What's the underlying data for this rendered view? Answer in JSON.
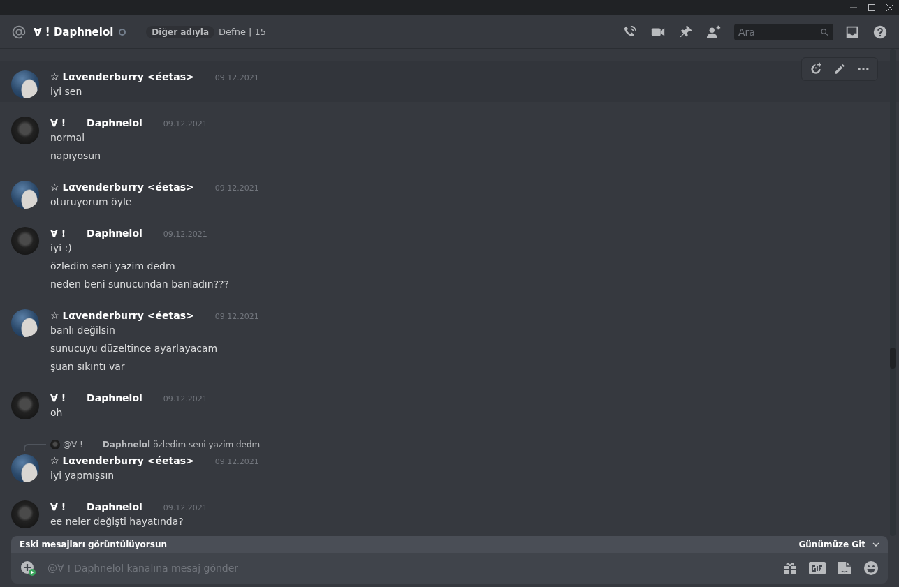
{
  "header": {
    "recipient": "∀ ! Daphnelol",
    "online": false,
    "nickname_label": "Diğer adıyla",
    "nickname": "Defne | 15",
    "search": {
      "placeholder": "Ara"
    }
  },
  "messages": [
    {
      "kind": "light",
      "author": [
        "☆ Lαvenderburry <éetas>"
      ],
      "timestamp": "09.12.2021",
      "highlighted": true,
      "lines": [
        "iyi sen"
      ]
    },
    {
      "kind": "dark",
      "author": [
        "∀ !",
        "Daphnelol"
      ],
      "timestamp": "09.12.2021",
      "highlighted": false,
      "lines": [
        "normal",
        "napıyosun"
      ]
    },
    {
      "kind": "light",
      "author": [
        "☆ Lαvenderburry <éetas>"
      ],
      "timestamp": "09.12.2021",
      "highlighted": false,
      "lines": [
        "oturuyorum öyle"
      ]
    },
    {
      "kind": "dark",
      "author": [
        "∀ !",
        "Daphnelol"
      ],
      "timestamp": "09.12.2021",
      "highlighted": false,
      "lines": [
        "iyi :)",
        "özledim seni yazim dedm",
        "neden beni sunucundan banladın???"
      ]
    },
    {
      "kind": "light",
      "author": [
        "☆ Lαvenderburry <éetas>"
      ],
      "timestamp": "09.12.2021",
      "highlighted": false,
      "lines": [
        "banlı değilsin",
        "sunucuyu düzeltince ayarlayacam",
        "şuan sıkıntı var"
      ]
    },
    {
      "kind": "dark",
      "author": [
        "∀ !",
        "Daphnelol"
      ],
      "timestamp": "09.12.2021",
      "highlighted": false,
      "lines": [
        "oh"
      ]
    },
    {
      "kind": "light",
      "author": [
        "☆ Lαvenderburry <éetas>"
      ],
      "timestamp": "09.12.2021",
      "highlighted": false,
      "reply": {
        "mention": "@∀ !",
        "author": "Daphnelol",
        "text": "özledim seni yazim dedm"
      },
      "lines": [
        "iyi yapmışsın"
      ]
    },
    {
      "kind": "dark",
      "author": [
        "∀ !",
        "Daphnelol"
      ],
      "timestamp": "09.12.2021",
      "highlighted": false,
      "lines": [
        "ee neler değişti hayatında?"
      ]
    }
  ],
  "banner": {
    "text": "Eski mesajları görüntülüyorsun",
    "action": "Günümüze Git"
  },
  "composer": {
    "placeholder": "@∀ ! Daphnelol kanalına mesaj gönder"
  }
}
